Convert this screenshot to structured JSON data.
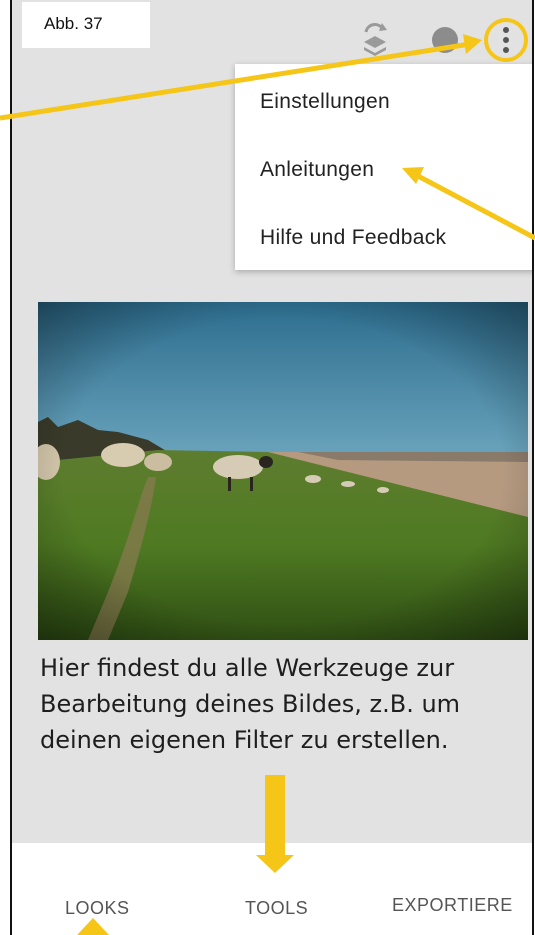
{
  "figure_label": "Abb. 37",
  "toolbar": {
    "undo_icon": "layers-undo-icon",
    "info_icon": "info-icon",
    "more_icon": "more-vert-icon"
  },
  "menu": {
    "items": [
      {
        "label": "Einstellungen"
      },
      {
        "label": "Anleitungen"
      },
      {
        "label": "Hilfe und Feedback"
      }
    ]
  },
  "description": {
    "line1": "Hier findest du alle Werkzeuge zur",
    "line2": "Bearbeitung deines Bildes, z.B. um",
    "line3": "deinen eigenen Filter zu erstellen."
  },
  "tabs": [
    {
      "label": "LOOKS"
    },
    {
      "label": "TOOLS"
    },
    {
      "label": "EXPORTIERE"
    }
  ],
  "colors": {
    "annotation": "#f5c518",
    "background": "#e2e2e2"
  }
}
